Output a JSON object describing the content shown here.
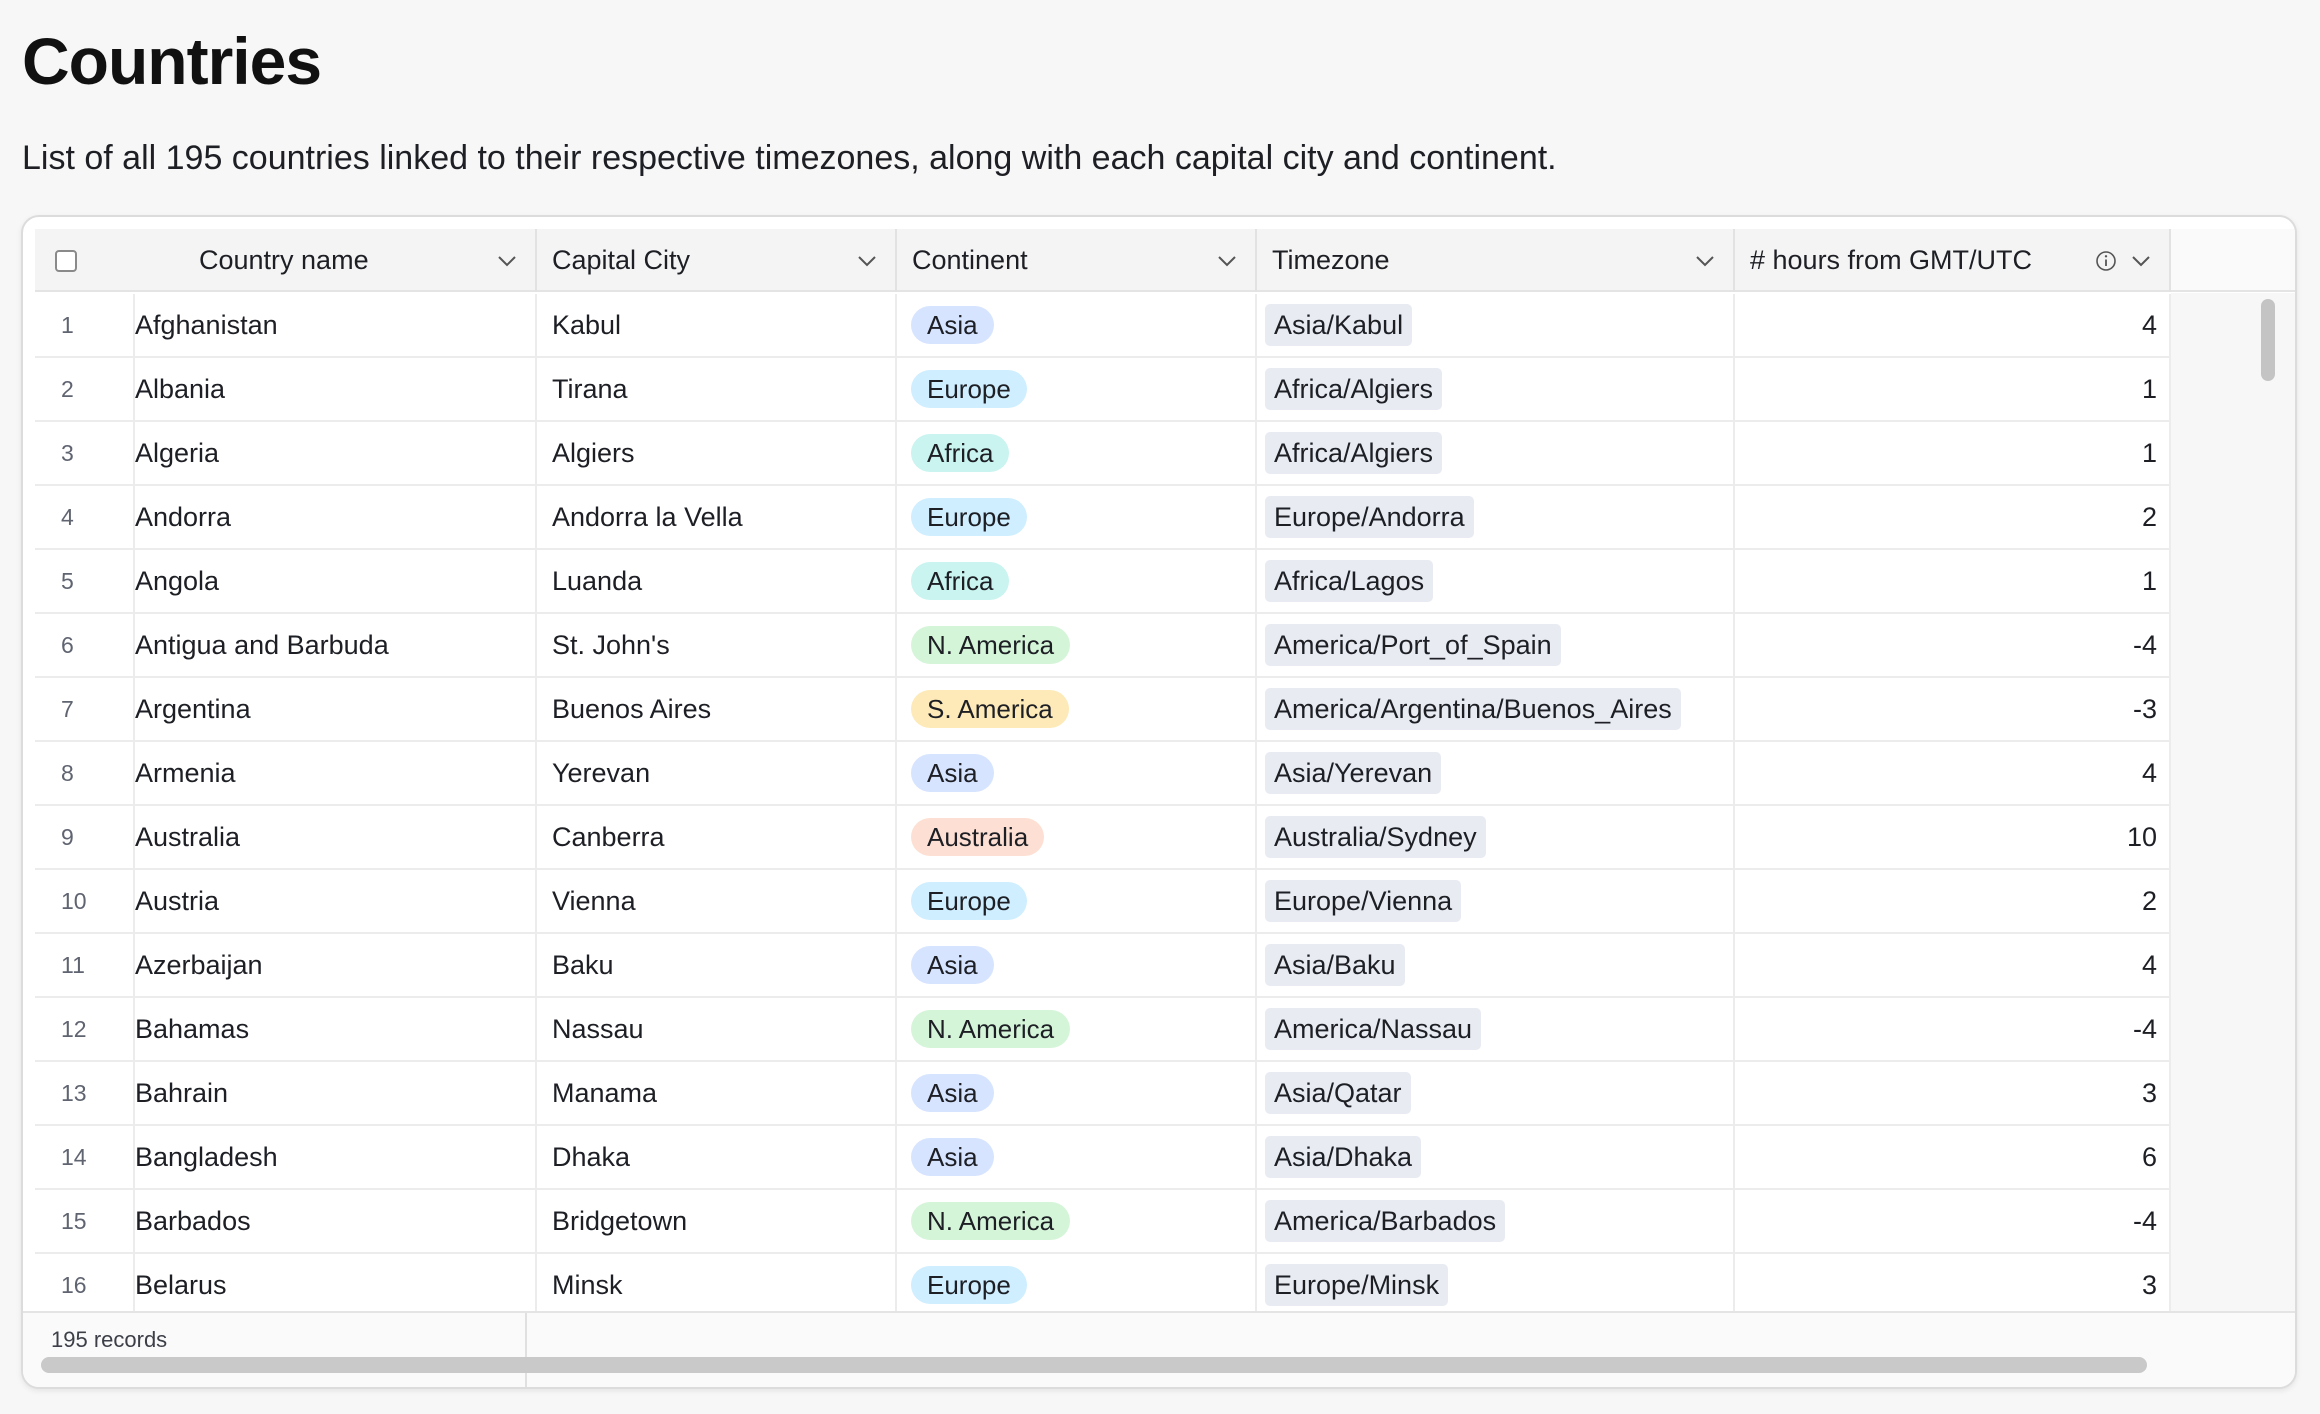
{
  "page": {
    "title": "Countries",
    "description": "List of all 195 countries linked to their respective timezones, along with each capital city and continent."
  },
  "columns": [
    {
      "label": "Country name"
    },
    {
      "label": "Capital City"
    },
    {
      "label": "Continent"
    },
    {
      "label": "Timezone"
    },
    {
      "label": "# hours from GMT/UTC"
    }
  ],
  "continent_colors": {
    "Asia": "#d6e4ff",
    "Europe": "#cfeeff",
    "Africa": "#c9f4ef",
    "N. America": "#d5f5d9",
    "S. America": "#fdeab8",
    "Australia": "#fde0d3"
  },
  "rows": [
    {
      "n": "1",
      "country": "Afghanistan",
      "capital": "Kabul",
      "continent": "Asia",
      "timezone": "Asia/Kabul",
      "offset": "4"
    },
    {
      "n": "2",
      "country": "Albania",
      "capital": "Tirana",
      "continent": "Europe",
      "timezone": "Africa/Algiers",
      "offset": "1"
    },
    {
      "n": "3",
      "country": "Algeria",
      "capital": "Algiers",
      "continent": "Africa",
      "timezone": "Africa/Algiers",
      "offset": "1"
    },
    {
      "n": "4",
      "country": "Andorra",
      "capital": "Andorra la Vella",
      "continent": "Europe",
      "timezone": "Europe/Andorra",
      "offset": "2"
    },
    {
      "n": "5",
      "country": "Angola",
      "capital": "Luanda",
      "continent": "Africa",
      "timezone": "Africa/Lagos",
      "offset": "1"
    },
    {
      "n": "6",
      "country": "Antigua and Barbuda",
      "capital": "St. John's",
      "continent": "N. America",
      "timezone": "America/Port_of_Spain",
      "offset": "-4"
    },
    {
      "n": "7",
      "country": "Argentina",
      "capital": "Buenos Aires",
      "continent": "S. America",
      "timezone": "America/Argentina/Buenos_Aires",
      "offset": "-3"
    },
    {
      "n": "8",
      "country": "Armenia",
      "capital": "Yerevan",
      "continent": "Asia",
      "timezone": "Asia/Yerevan",
      "offset": "4"
    },
    {
      "n": "9",
      "country": "Australia",
      "capital": "Canberra",
      "continent": "Australia",
      "timezone": "Australia/Sydney",
      "offset": "10"
    },
    {
      "n": "10",
      "country": "Austria",
      "capital": "Vienna",
      "continent": "Europe",
      "timezone": "Europe/Vienna",
      "offset": "2"
    },
    {
      "n": "11",
      "country": "Azerbaijan",
      "capital": "Baku",
      "continent": "Asia",
      "timezone": "Asia/Baku",
      "offset": "4"
    },
    {
      "n": "12",
      "country": "Bahamas",
      "capital": "Nassau",
      "continent": "N. America",
      "timezone": "America/Nassau",
      "offset": "-4"
    },
    {
      "n": "13",
      "country": "Bahrain",
      "capital": "Manama",
      "continent": "Asia",
      "timezone": "Asia/Qatar",
      "offset": "3"
    },
    {
      "n": "14",
      "country": "Bangladesh",
      "capital": "Dhaka",
      "continent": "Asia",
      "timezone": "Asia/Dhaka",
      "offset": "6"
    },
    {
      "n": "15",
      "country": "Barbados",
      "capital": "Bridgetown",
      "continent": "N. America",
      "timezone": "America/Barbados",
      "offset": "-4"
    },
    {
      "n": "16",
      "country": "Belarus",
      "capital": "Minsk",
      "continent": "Europe",
      "timezone": "Europe/Minsk",
      "offset": "3"
    }
  ],
  "footer": {
    "records_label": "195 records"
  }
}
